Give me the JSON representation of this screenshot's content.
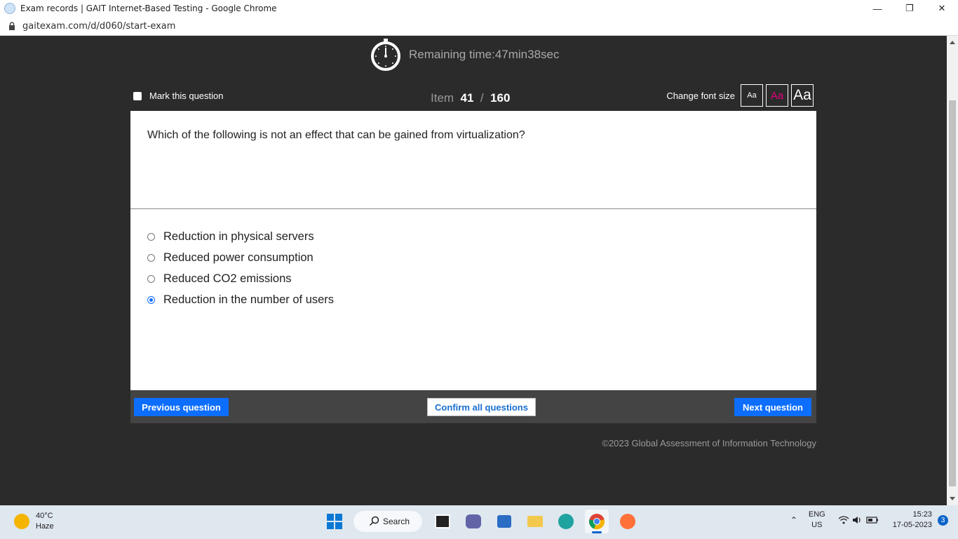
{
  "browser": {
    "window_title": "Exam records | GAIT Internet-Based Testing - Google Chrome",
    "url": "gaitexam.com/d/d060/start-exam"
  },
  "exam": {
    "remaining_time": "Remaining time:47min38sec",
    "mark_label": "Mark this question",
    "item_label": "Item",
    "item_current": "41",
    "item_sep": "/",
    "item_total": "160",
    "font_size_label": "Change font size",
    "font_buttons": [
      "Aa",
      "Aa",
      "Aa"
    ],
    "question": "Which of the following is not an effect that can be gained from virtualization?",
    "options": [
      {
        "label": "Reduction in physical servers",
        "selected": false
      },
      {
        "label": "Reduced power consumption",
        "selected": false
      },
      {
        "label": "Reduced CO2 emissions",
        "selected": false
      },
      {
        "label": "Reduction in the number of users",
        "selected": true
      }
    ],
    "prev_label": "Previous question",
    "confirm_label": "Confirm all questions",
    "next_label": "Next question",
    "copyright": "©2023 Global Assessment of Information Technology",
    "accent_color": "#0d6efd",
    "font_button_colors": [
      "#ffffff",
      "#e6007e",
      "#ffffff"
    ]
  },
  "taskbar": {
    "temperature": "40°C",
    "weather": "Haze",
    "search_label": "Search",
    "lang_top": "ENG",
    "lang_bottom": "US",
    "time": "15:23",
    "date": "17-05-2023",
    "notification_count": "3"
  }
}
